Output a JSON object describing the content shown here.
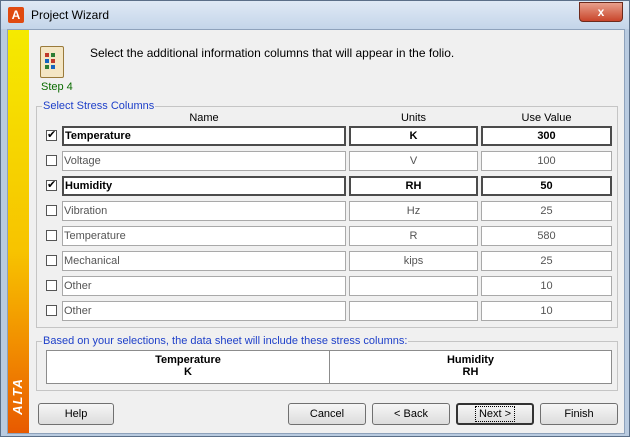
{
  "window": {
    "title": "Project Wizard",
    "close_glyph": "x",
    "app_icon_text": "A"
  },
  "sidebar": {
    "brand": "ALTA"
  },
  "step": {
    "label": "Step 4",
    "instruction": "Select the additional information columns that will appear in the folio."
  },
  "stress_columns": {
    "legend": "Select Stress Columns",
    "headers": {
      "name": "Name",
      "units": "Units",
      "use_value": "Use Value"
    },
    "rows": [
      {
        "checked": true,
        "name": "Temperature",
        "units": "K",
        "value": "300"
      },
      {
        "checked": false,
        "name": "Voltage",
        "units": "V",
        "value": "100"
      },
      {
        "checked": true,
        "name": "Humidity",
        "units": "RH",
        "value": "50"
      },
      {
        "checked": false,
        "name": "Vibration",
        "units": "Hz",
        "value": "25"
      },
      {
        "checked": false,
        "name": "Temperature",
        "units": "R",
        "value": "580"
      },
      {
        "checked": false,
        "name": "Mechanical",
        "units": "kips",
        "value": "25"
      },
      {
        "checked": false,
        "name": "Other",
        "units": "",
        "value": "10"
      },
      {
        "checked": false,
        "name": "Other",
        "units": "",
        "value": "10"
      }
    ]
  },
  "summary": {
    "legend": "Based on your selections, the data sheet will include these stress columns:",
    "columns": [
      {
        "name": "Temperature",
        "units": "K"
      },
      {
        "name": "Humidity",
        "units": "RH"
      }
    ]
  },
  "buttons": {
    "help": "Help",
    "cancel": "Cancel",
    "back": "< Back",
    "next": "Next >",
    "finish": "Finish"
  },
  "colors": {
    "legend_text": "#1d3fc9",
    "step_text": "#0a6b00",
    "sidebar_top": "#f5ea00",
    "sidebar_bottom": "#e85a00"
  }
}
